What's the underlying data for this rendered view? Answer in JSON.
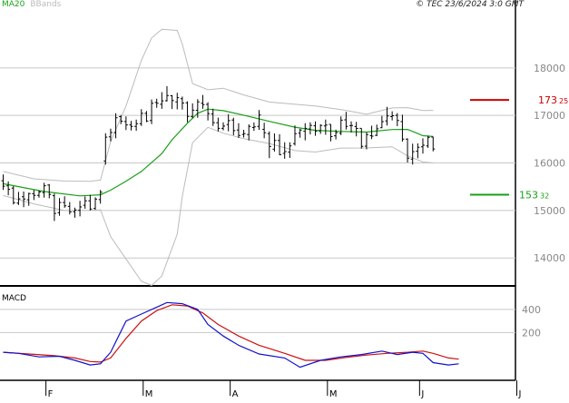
{
  "header": {
    "ma_legend": "MA20",
    "bb_legend": "BBands",
    "copyright": "© TEC 23/6/2024 3:0 GMT"
  },
  "chart_data": {
    "type": "ohlc",
    "price_panel": {
      "y_ticks": [
        "18000",
        "17000",
        "16000",
        "15000",
        "14000"
      ],
      "y_tick_values": [
        18000,
        17000,
        16000,
        15000,
        14000
      ],
      "ylim": [
        13450,
        19200
      ],
      "resistance": {
        "value": 17325,
        "label_main": "173",
        "label_sup": "25",
        "color": "#cc0000"
      },
      "support": {
        "value": 15332,
        "label_main": "153",
        "label_sup": "32",
        "color": "#18a018"
      },
      "ma_color": "#18a018",
      "bband_color": "#bbbbbb",
      "bar_color": "#000000",
      "candles": [
        [
          15625,
          15756,
          15432,
          15511
        ],
        [
          15519,
          15611,
          15321,
          15445
        ],
        [
          15470,
          15511,
          15128,
          15165
        ],
        [
          15154,
          15390,
          15114,
          15244
        ],
        [
          15287,
          15399,
          15068,
          15240
        ],
        [
          15224,
          15373,
          15099,
          15356
        ],
        [
          15352,
          15430,
          15218,
          15316
        ],
        [
          15318,
          15422,
          15270,
          15388
        ],
        [
          15375,
          15581,
          15270,
          15520
        ],
        [
          15534,
          15556,
          15256,
          15337
        ],
        [
          15310,
          15357,
          14778,
          14938
        ],
        [
          14951,
          15259,
          14886,
          15167
        ],
        [
          15167,
          15299,
          15057,
          15097
        ],
        [
          15085,
          15179,
          14915,
          14968
        ],
        [
          14972,
          15059,
          14846,
          15009
        ],
        [
          15002,
          15203,
          14876,
          15073
        ],
        [
          15110,
          15295,
          15036,
          15202
        ],
        [
          15204,
          15326,
          14999,
          15030
        ],
        [
          15044,
          15276,
          15014,
          15238
        ],
        [
          15229,
          15433,
          15142,
          15384
        ],
        [
          16040,
          16624,
          15963,
          16542
        ],
        [
          16550,
          16720,
          16454,
          16640
        ],
        [
          16638,
          17048,
          16518,
          16952
        ],
        [
          16975,
          17007,
          16818,
          16879
        ],
        [
          16872,
          16980,
          16692,
          16800
        ],
        [
          16800,
          16884,
          16684,
          16771
        ],
        [
          16768,
          16912,
          16676,
          16826
        ],
        [
          16826,
          17133,
          16777,
          17044
        ],
        [
          17044,
          17095,
          16859,
          16880
        ],
        [
          16895,
          17335,
          16817,
          17256
        ],
        [
          17272,
          17350,
          17160,
          17256
        ],
        [
          17235,
          17490,
          17138,
          17306
        ],
        [
          17308,
          17615,
          17291,
          17418
        ],
        [
          17414,
          17429,
          17135,
          17312
        ],
        [
          17285,
          17475,
          17127,
          17374
        ],
        [
          17350,
          17396,
          17121,
          17261
        ],
        [
          17264,
          17298,
          16854,
          16978
        ],
        [
          16976,
          17254,
          16941,
          17110
        ],
        [
          17108,
          17343,
          16952,
          17286
        ],
        [
          17256,
          17432,
          17138,
          17228
        ],
        [
          17233,
          17279,
          16893,
          17039
        ],
        [
          17029,
          17142,
          16778,
          16848
        ],
        [
          16844,
          16953,
          16661,
          16728
        ],
        [
          16728,
          16857,
          16687,
          16775
        ],
        [
          16808,
          17024,
          16666,
          16891
        ],
        [
          16903,
          16952,
          16582,
          16681
        ],
        [
          16693,
          16835,
          16526,
          16579
        ],
        [
          16600,
          16698,
          16536,
          16618
        ],
        [
          16598,
          16812,
          16474,
          16770
        ],
        [
          16745,
          16853,
          16672,
          16760
        ],
        [
          16770,
          17113,
          16697,
          17008
        ],
        [
          16708,
          16847,
          16522,
          16637
        ],
        [
          16616,
          16663,
          16102,
          16346
        ],
        [
          16288,
          16622,
          16239,
          16472
        ],
        [
          16473,
          16604,
          16160,
          16174
        ],
        [
          16200,
          16433,
          16088,
          16239
        ],
        [
          16228,
          16434,
          16106,
          16357
        ],
        [
          16405,
          16788,
          16365,
          16615
        ],
        [
          16624,
          16718,
          16530,
          16691
        ],
        [
          16667,
          16835,
          16476,
          16729
        ],
        [
          16714,
          16855,
          16600,
          16791
        ],
        [
          16781,
          16875,
          16571,
          16666
        ],
        [
          16673,
          16814,
          16611,
          16791
        ],
        [
          16779,
          16911,
          16592,
          16798
        ],
        [
          16812,
          16814,
          16455,
          16554
        ],
        [
          16571,
          16702,
          16495,
          16640
        ],
        [
          16627,
          16981,
          16584,
          16900
        ],
        [
          16908,
          17074,
          16702,
          16769
        ],
        [
          16786,
          16873,
          16641,
          16788
        ],
        [
          16766,
          16865,
          16559,
          16727
        ],
        [
          16728,
          16729,
          16302,
          16347
        ],
        [
          16354,
          16646,
          16286,
          16598
        ],
        [
          16574,
          16784,
          16503,
          16564
        ],
        [
          16581,
          16807,
          16564,
          16719
        ],
        [
          16740,
          16992,
          16732,
          16869
        ],
        [
          16884,
          17179,
          16788,
          16988
        ],
        [
          16974,
          17087,
          16897,
          16993
        ],
        [
          17002,
          17049,
          16773,
          16894
        ],
        [
          16869,
          17014,
          16449,
          16502
        ],
        [
          16503,
          16517,
          16010,
          16100
        ],
        [
          16082,
          16405,
          15966,
          16237
        ],
        [
          16246,
          16411,
          16097,
          16330
        ],
        [
          16338,
          16517,
          16197,
          16373
        ],
        [
          16359,
          16574,
          16318,
          16541
        ],
        [
          16545,
          16553,
          16244,
          16294
        ]
      ],
      "ma20": [
        [
          0,
          15563
        ],
        [
          8,
          15399
        ],
        [
          15,
          15307
        ],
        [
          19,
          15330
        ],
        [
          21,
          15427
        ],
        [
          24,
          15617
        ],
        [
          27,
          15820
        ],
        [
          31,
          16197
        ],
        [
          33,
          16487
        ],
        [
          36,
          16835
        ],
        [
          38,
          17046
        ],
        [
          40,
          17133
        ],
        [
          43,
          17101
        ],
        [
          47,
          17005
        ],
        [
          52,
          16876
        ],
        [
          57,
          16752
        ],
        [
          61,
          16686
        ],
        [
          66,
          16663
        ],
        [
          71,
          16650
        ],
        [
          76,
          16703
        ],
        [
          79,
          16705
        ],
        [
          81,
          16619
        ],
        [
          82,
          16574
        ],
        [
          84,
          16558
        ]
      ],
      "bb_upper": [
        [
          0,
          15820
        ],
        [
          6,
          15665
        ],
        [
          12,
          15618
        ],
        [
          17,
          15615
        ],
        [
          19,
          15640
        ],
        [
          21,
          16450
        ],
        [
          24,
          17200
        ],
        [
          27,
          18160
        ],
        [
          29,
          18630
        ],
        [
          31,
          18812
        ],
        [
          34,
          18790
        ],
        [
          35,
          18500
        ],
        [
          37,
          17670
        ],
        [
          40,
          17540
        ],
        [
          43,
          17573
        ],
        [
          47,
          17432
        ],
        [
          52,
          17283
        ],
        [
          57,
          17234
        ],
        [
          61,
          17198
        ],
        [
          66,
          17124
        ],
        [
          71,
          17024
        ],
        [
          76,
          17157
        ],
        [
          79,
          17164
        ],
        [
          82,
          17103
        ],
        [
          84,
          17106
        ]
      ],
      "bb_lower": [
        [
          0,
          15314
        ],
        [
          6,
          15139
        ],
        [
          12,
          14999
        ],
        [
          17,
          15002
        ],
        [
          19,
          15014
        ],
        [
          21,
          14450
        ],
        [
          24,
          13980
        ],
        [
          27,
          13510
        ],
        [
          29,
          13422
        ],
        [
          31,
          13620
        ],
        [
          34,
          14500
        ],
        [
          35,
          15300
        ],
        [
          37,
          16426
        ],
        [
          40,
          16750
        ],
        [
          43,
          16627
        ],
        [
          47,
          16511
        ],
        [
          52,
          16410
        ],
        [
          57,
          16260
        ],
        [
          61,
          16230
        ],
        [
          66,
          16314
        ],
        [
          71,
          16316
        ],
        [
          76,
          16340
        ],
        [
          79,
          16150
        ],
        [
          82,
          16020
        ],
        [
          84,
          16000
        ]
      ]
    },
    "macd_panel": {
      "title": "MACD",
      "y_ticks": [
        "400",
        "200"
      ],
      "y_tick_values": [
        400,
        200
      ],
      "ylim": [
        -205,
        580
      ],
      "macd_color": "#1111cc",
      "signal_color": "#cc1111",
      "macd": [
        [
          0,
          30
        ],
        [
          3,
          20
        ],
        [
          7,
          -10
        ],
        [
          11,
          -5
        ],
        [
          14,
          -40
        ],
        [
          17,
          -80
        ],
        [
          19,
          -70
        ],
        [
          21,
          30
        ],
        [
          24,
          300
        ],
        [
          27,
          360
        ],
        [
          30,
          420
        ],
        [
          32,
          460
        ],
        [
          35,
          450
        ],
        [
          38,
          400
        ],
        [
          40,
          270
        ],
        [
          43,
          170
        ],
        [
          46,
          90
        ],
        [
          50,
          15
        ],
        [
          55,
          -20
        ],
        [
          58,
          -100
        ],
        [
          62,
          -40
        ],
        [
          66,
          -10
        ],
        [
          70,
          10
        ],
        [
          74,
          40
        ],
        [
          77,
          10
        ],
        [
          80,
          30
        ],
        [
          82,
          20
        ],
        [
          84,
          -60
        ],
        [
          87,
          -80
        ],
        [
          89,
          -70
        ]
      ],
      "signal": [
        [
          0,
          30
        ],
        [
          5,
          15
        ],
        [
          10,
          0
        ],
        [
          14,
          -20
        ],
        [
          17,
          -50
        ],
        [
          19,
          -55
        ],
        [
          21,
          -20
        ],
        [
          24,
          150
        ],
        [
          27,
          300
        ],
        [
          30,
          390
        ],
        [
          33,
          440
        ],
        [
          36,
          430
        ],
        [
          39,
          370
        ],
        [
          42,
          270
        ],
        [
          46,
          170
        ],
        [
          50,
          90
        ],
        [
          55,
          20
        ],
        [
          59,
          -40
        ],
        [
          63,
          -40
        ],
        [
          67,
          -15
        ],
        [
          71,
          5
        ],
        [
          75,
          20
        ],
        [
          79,
          30
        ],
        [
          82,
          40
        ],
        [
          84,
          20
        ],
        [
          87,
          -20
        ],
        [
          89,
          -30
        ]
      ]
    },
    "x_axis": {
      "labels": [
        "F",
        "M",
        "A",
        "M",
        "J",
        "J"
      ],
      "label_idx": [
        8,
        27,
        44,
        63,
        81,
        100
      ],
      "total_slots": 100
    }
  }
}
